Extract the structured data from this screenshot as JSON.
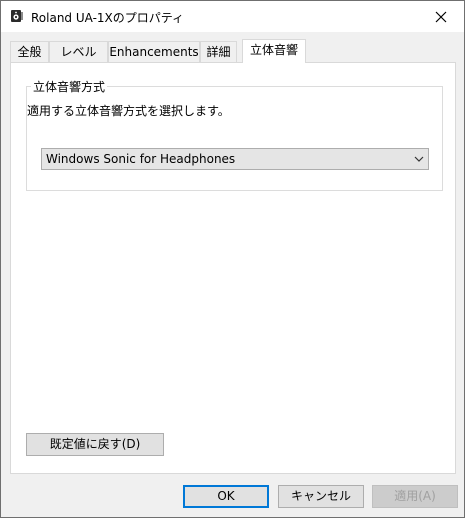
{
  "window": {
    "title": "Roland UA-1Xのプロパティ",
    "icon": "speaker-icon",
    "close_icon": "close-icon"
  },
  "tabs": [
    {
      "label": "全般"
    },
    {
      "label": "レベル"
    },
    {
      "label": "Enhancements"
    },
    {
      "label": "詳細"
    },
    {
      "label": "立体音響",
      "active": true
    }
  ],
  "spatial": {
    "group_title": "立体音響方式",
    "description": "適用する立体音響方式を選択します。",
    "format_value": "Windows Sonic for Headphones"
  },
  "buttons": {
    "restore": "既定値に戻す(D)",
    "ok": "OK",
    "cancel": "キャンセル",
    "apply": "適用(A)"
  },
  "colors": {
    "default_button_border": "#0078d7",
    "disabled_text": "#a0a0a0"
  }
}
